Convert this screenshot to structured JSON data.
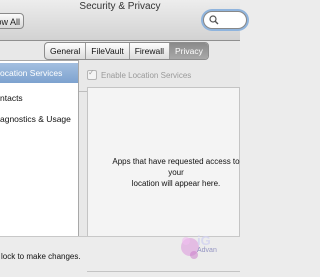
{
  "window": {
    "title": "Security & Privacy"
  },
  "toolbar": {
    "show_all_label": "ow All",
    "search_placeholder": ""
  },
  "tabs": [
    {
      "label": "General"
    },
    {
      "label": "FileVault"
    },
    {
      "label": "Firewall"
    },
    {
      "label": "Privacy"
    }
  ],
  "sidebar": {
    "items": [
      {
        "label": "ocation Services"
      },
      {
        "label": "ntacts"
      },
      {
        "label": "agnostics & Usage"
      }
    ]
  },
  "privacy": {
    "enable_location_label": "Enable Location Services",
    "empty_message_line1": "Apps that have requested access to your",
    "empty_message_line2": "location will appear here."
  },
  "footer": {
    "lock_text": "lock to make changes."
  },
  "watermark": {
    "text": "iG",
    "sub": "Advan"
  }
}
